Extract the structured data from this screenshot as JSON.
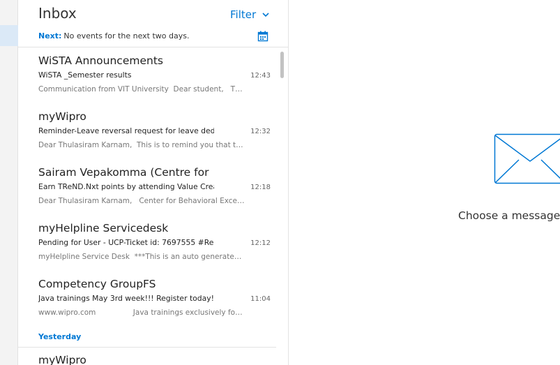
{
  "inbox": {
    "title": "Inbox",
    "filter_label": "Filter",
    "next_label": "Next:",
    "next_text": "No events for the next two days."
  },
  "messages": [
    {
      "sender": "WiSTA Announcements",
      "subject": "WiSTA _Semester results",
      "time": "12:43",
      "preview": "Communication from VIT University  Dear student,   The..."
    },
    {
      "sender": "myWipro",
      "subject": "Reminder-Leave reversal request for leave dedu",
      "time": "12:32",
      "preview": "Dear Thulasiram Karnam,  This is to remind you that the..."
    },
    {
      "sender": "Sairam Vepakomma (Centre for ...",
      "subject": "Earn TReND.Nxt points by attending Value Creat",
      "time": "12:18",
      "preview": "Dear Thulasiram Karnam,   Center for Behavioral Excelle..."
    },
    {
      "sender": "myHelpline Servicedesk",
      "subject": "Pending for User - UCP-Ticket id: 7697555 #Ren",
      "time": "12:12",
      "preview": "myHelpline Service Desk  ***This is an auto generated ..."
    },
    {
      "sender": "Competency GroupFS",
      "subject": "Java trainings May 3rd week!!! Register today!!",
      "time": "11:04",
      "preview": "www.wipro.com                Java trainings exclusively for  y..."
    }
  ],
  "yesterday_group": {
    "label": "Yesterday",
    "first_sender": "myWipro"
  },
  "reading_pane": {
    "empty_text": "Choose a message t"
  },
  "colors": {
    "accent": "#0078d4",
    "selected_nav": "#dbe9f7"
  },
  "icons": {
    "filter": "chevron-down-icon",
    "calendar": "calendar-icon",
    "empty": "envelope-icon"
  }
}
